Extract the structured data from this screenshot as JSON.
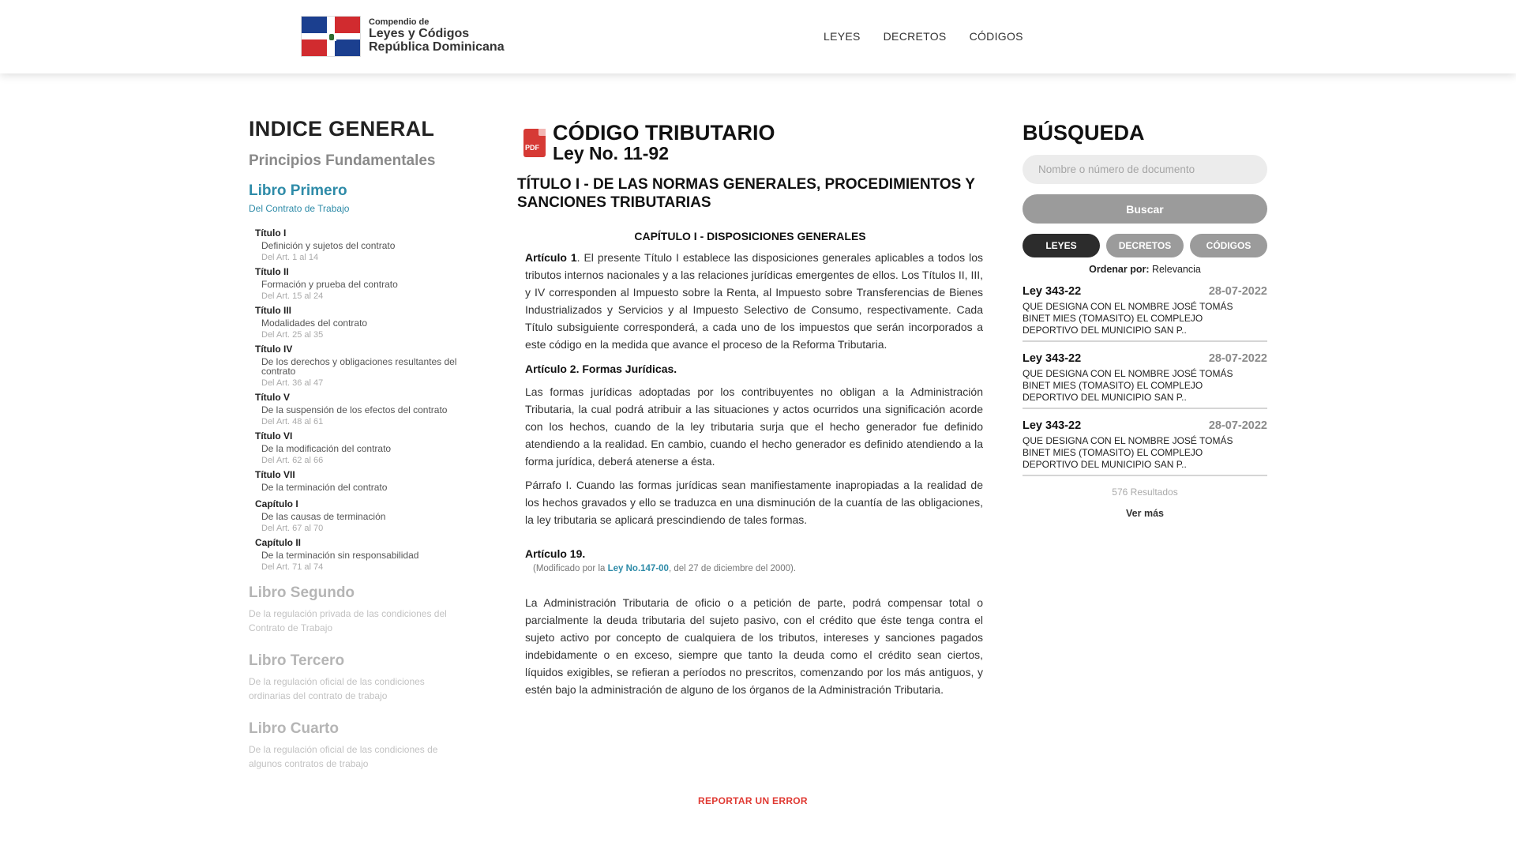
{
  "header": {
    "logo_small": "Compendio de",
    "logo_line1": "Leyes y Códigos",
    "logo_line2": "República Dominicana",
    "nav": [
      "LEYES",
      "DECRETOS",
      "CÓDIGOS"
    ]
  },
  "index": {
    "title": "INDICE GENERAL",
    "principios": "Principios Fundamentales",
    "libro_primero": "Libro Primero",
    "libro_primero_sub": "Del Contrato de Trabajo",
    "titulos": [
      {
        "name": "Título I",
        "desc": "Definición y sujetos del contrato",
        "range": "Del Art. 1 al 14"
      },
      {
        "name": "Título II",
        "desc": "Formación y prueba del contrato",
        "range": "Del Art. 15 al 24"
      },
      {
        "name": "Título III",
        "desc": "Modalidades del contrato",
        "range": "Del Art. 25 al 35"
      },
      {
        "name": "Título IV",
        "desc": "De los derechos y obligaciones resultantes del contrato",
        "range": "Del Art. 36 al 47"
      },
      {
        "name": "Título V",
        "desc": "De la suspensión de los efectos del contrato",
        "range": "Del Art. 48 al 61"
      },
      {
        "name": "Título VI",
        "desc": "De la modificación del contrato",
        "range": "Del Art. 62 al 66"
      },
      {
        "name": "Título VII",
        "desc": "De la terminación del contrato",
        "range": ""
      },
      {
        "name": "Capítulo I",
        "desc": "De las causas de terminación",
        "range": "Del Art. 67 al 70"
      },
      {
        "name": "Capítulo II",
        "desc": "De la terminación sin responsabilidad",
        "range": "Del Art. 71 al 74"
      }
    ],
    "libros": [
      {
        "name": "Libro Segundo",
        "sub": "De la regulación privada de las condiciones del Contrato de Trabajo"
      },
      {
        "name": "Libro Tercero",
        "sub": "De la regulación oficial de las condiciones ordinarias del contrato de trabajo"
      },
      {
        "name": "Libro Cuarto",
        "sub": "De la regulación oficial de las condiciones de algunos contratos de trabajo"
      }
    ]
  },
  "document": {
    "pdf_label": "PDF",
    "title": "CÓDIGO TRIBUTARIO",
    "subtitle": "Ley No. 11-92",
    "titulo": "TÍTULO I - DE LAS NORMAS GENERALES, PROCEDIMIENTOS Y SANCIONES TRIBUTARIAS",
    "capitulo": "CAPÍTULO I - DISPOSICIONES GENERALES",
    "art1_label": "Artículo 1",
    "art1_text": ". El presente Título I establece las disposiciones generales aplicables a todos los tributos internos nacionales y a las relaciones jurídicas emergentes de ellos. Los Títulos II, III, y IV corresponden al Impuesto sobre la Renta, al Impuesto sobre Transferencias de Bienes Industrializados y Servicios y al Impuesto Selectivo de Consumo, respectivamente. Cada Título subsiguiente corresponderá, a cada uno de los impuestos que serán incorporados a este código en la medida que avance el proceso de la Reforma Tributaria.",
    "art2_heading": "Artículo 2. Formas Jurídicas.",
    "art2_text": "Las formas jurídicas adoptadas por los contribuyentes no obligan a la Administración Tributaria, la cual podrá atribuir a las situaciones y actos ocurridos una significación acorde con los hechos, cuando de la ley tributaria surja que el hecho generador fue definido atendiendo a la realidad. En cambio, cuando el hecho generador es definido atendiendo a la forma jurídica, deberá atenerse a ésta.",
    "parrafo": "Párrafo I. Cuando las formas jurídicas sean manifiestamente inapropiadas a la realidad de los hechos gravados y ello se traduzca en una disminución de la cuantía de las obligaciones, la ley tributaria se aplicará prescindiendo de tales formas.",
    "art19_heading": "Artículo 19.",
    "mod_prefix": "(Modificado por la ",
    "mod_link": "Ley No.147-00",
    "mod_suffix": ", del 27 de diciembre del 2000).",
    "art19_text": "La Administración Tributaria de oficio o a petición de parte, podrá compensar total o parcialmente la deuda tributaria del sujeto pasivo, con el crédito que éste tenga contra el sujeto activo por concepto de cualquiera de los tributos, intereses y sanciones pagados indebidamente o en exceso, siempre que tanto la deuda como el crédito sean ciertos, líquidos exigibles, se refieran a períodos no prescritos, comenzando por los más antiguos, y estén bajo la administración de alguno de los órganos de la Administración Tributaria.",
    "report": "REPORTAR UN ERROR"
  },
  "search": {
    "title": "BÚSQUEDA",
    "placeholder": "Nombre o número de documento",
    "button": "Buscar",
    "filters": [
      "LEYES",
      "DECRETOS",
      "CÓDIGOS"
    ],
    "order_label": "Ordenar por:",
    "order_value": " Relevancia",
    "results": [
      {
        "ley": "Ley 343-22",
        "date": "28-07-2022",
        "desc": "QUE DESIGNA CON EL NOMBRE JOSÉ TOMÁS BINET MIES (TOMASITO) EL COMPLEJO DEPORTIVO DEL MUNICIPIO SAN P.."
      },
      {
        "ley": "Ley 343-22",
        "date": "28-07-2022",
        "desc": "QUE DESIGNA CON EL NOMBRE JOSÉ TOMÁS BINET MIES (TOMASITO) EL COMPLEJO DEPORTIVO DEL MUNICIPIO SAN P.."
      },
      {
        "ley": "Ley 343-22",
        "date": "28-07-2022",
        "desc": "QUE DESIGNA CON EL NOMBRE JOSÉ TOMÁS BINET MIES (TOMASITO) EL COMPLEJO DEPORTIVO DEL MUNICIPIO SAN P.."
      }
    ],
    "count": "576 Resultados",
    "more": "Ver más"
  },
  "colors": {
    "accent": "#2e8ba8",
    "report": "#e03a33",
    "button_gray": "#9b9b9b",
    "active_filter": "#2c2c2c"
  }
}
